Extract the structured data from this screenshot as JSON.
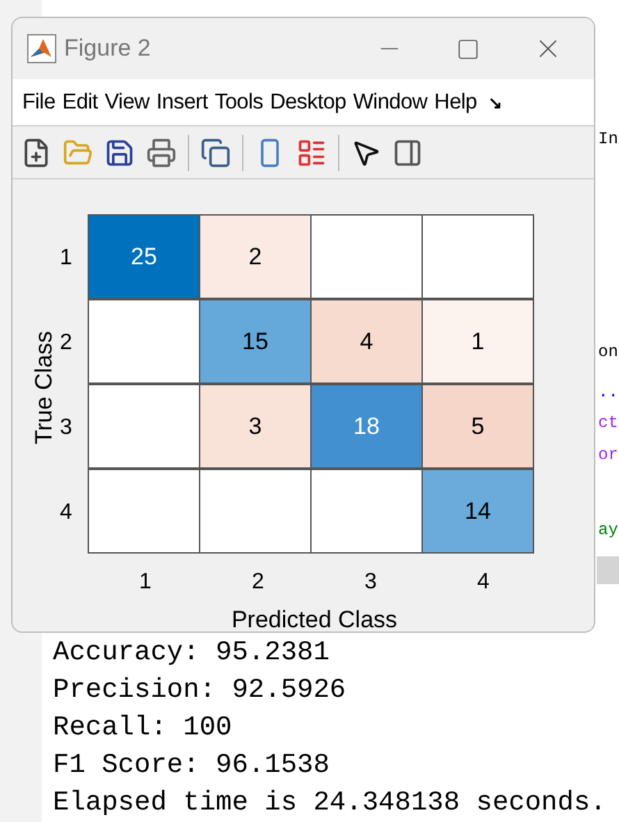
{
  "editor_fragments": [
    {
      "text": "In",
      "color": "#000000"
    },
    {
      "text": "on",
      "color": "#000000"
    },
    {
      "text": "..",
      "color": "#0000ff"
    },
    {
      "text": "ct",
      "color": "#a020f0"
    },
    {
      "text": "or",
      "color": "#a020f0"
    },
    {
      "text": "ay",
      "color": "#028009"
    }
  ],
  "window": {
    "title": "Figure 2"
  },
  "menu": [
    "File",
    "Edit",
    "View",
    "Insert",
    "Tools",
    "Desktop",
    "Window",
    "Help"
  ],
  "menu_overflow": "↘",
  "confusion_chart": {
    "ylabel": "True Class",
    "xlabel": "Predicted Class",
    "row_labels": [
      "1",
      "2",
      "3",
      "4"
    ],
    "column_labels": [
      "1",
      "2",
      "3",
      "4"
    ],
    "rows": [
      [
        {
          "value": "25",
          "color": "#0072bd"
        },
        {
          "value": "2",
          "color": "#fbe9e3"
        },
        {
          "color": "#ffffff"
        },
        {
          "color": "#ffffff"
        }
      ],
      [
        {
          "color": "#ffffff"
        },
        {
          "value": "15",
          "color": "#65a9db"
        },
        {
          "value": "4",
          "color": "#f7dbcf"
        },
        {
          "value": "1",
          "color": "#fcf2ee"
        }
      ],
      [
        {
          "color": "#ffffff"
        },
        {
          "value": "3",
          "color": "#f9e2d8"
        },
        {
          "value": "18",
          "color": "#4290d0"
        },
        {
          "value": "5",
          "color": "#f5d6c9"
        }
      ],
      [
        {
          "color": "#ffffff"
        },
        {
          "color": "#ffffff"
        },
        {
          "color": "#ffffff"
        },
        {
          "value": "14",
          "color": "#6aabdc"
        }
      ]
    ]
  },
  "console": [
    "Accuracy: 95.2381",
    "Precision: 92.5926",
    "Recall: 100",
    "F1 Score: 96.1538",
    "Elapsed time is 24.348138 seconds."
  ]
}
